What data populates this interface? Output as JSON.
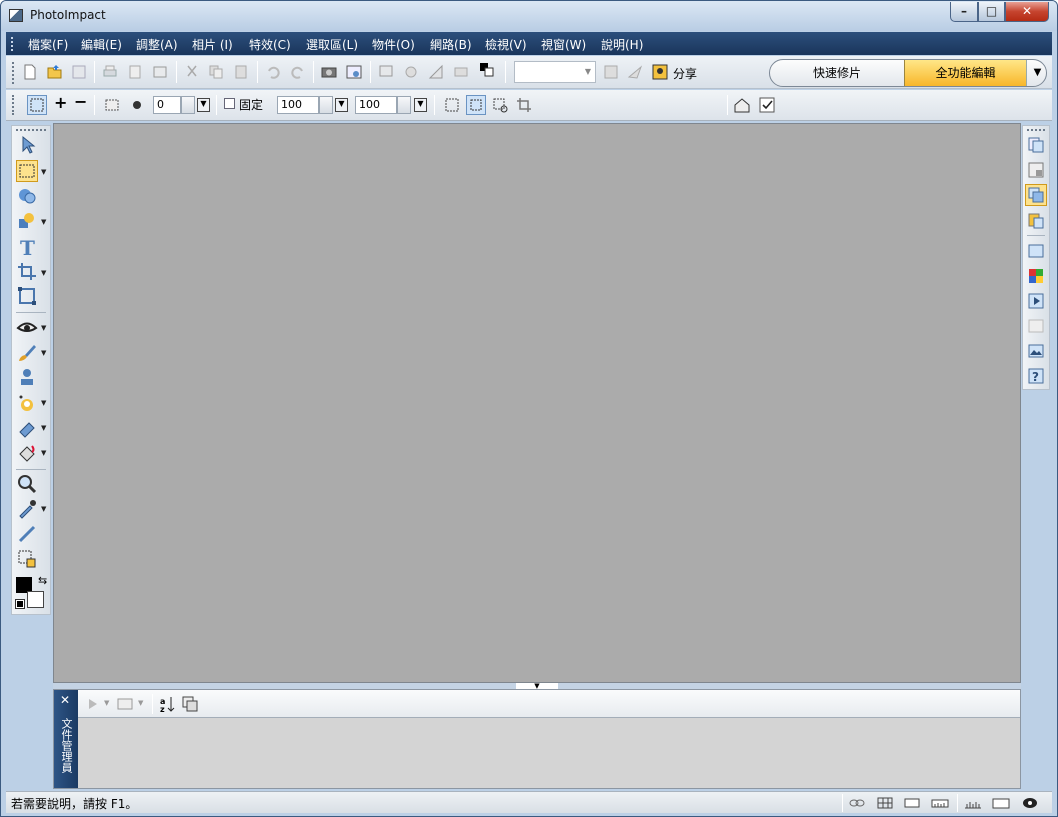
{
  "window": {
    "title": "PhotoImpact",
    "min_label": "–",
    "max_label": "□",
    "close_label": "✕"
  },
  "menu": [
    {
      "label": "檔案(F)"
    },
    {
      "label": "編輯(E)"
    },
    {
      "label": "調整(A)"
    },
    {
      "label": "相片 (I)"
    },
    {
      "label": "特效(C)"
    },
    {
      "label": "選取區(L)"
    },
    {
      "label": "物件(O)"
    },
    {
      "label": "網路(B)"
    },
    {
      "label": "檢視(V)"
    },
    {
      "label": "視窗(W)"
    },
    {
      "label": "說明(H)"
    }
  ],
  "toolbar": {
    "share_label": "分享",
    "mode_quick": "快速修片",
    "mode_full": "全功能編輯",
    "mode_arrow": "▼"
  },
  "options": {
    "soft_edge": "0",
    "fixed_label": "固定",
    "width": "100",
    "height": "100"
  },
  "docmgr": {
    "close": "✕",
    "label": "文件管理員"
  },
  "status": {
    "text": "若需要說明，請按 F1。"
  },
  "colors": {
    "foreground": "#000000",
    "background": "#ffffff",
    "accent": "#f8b62a",
    "workspace": "#ababab"
  }
}
